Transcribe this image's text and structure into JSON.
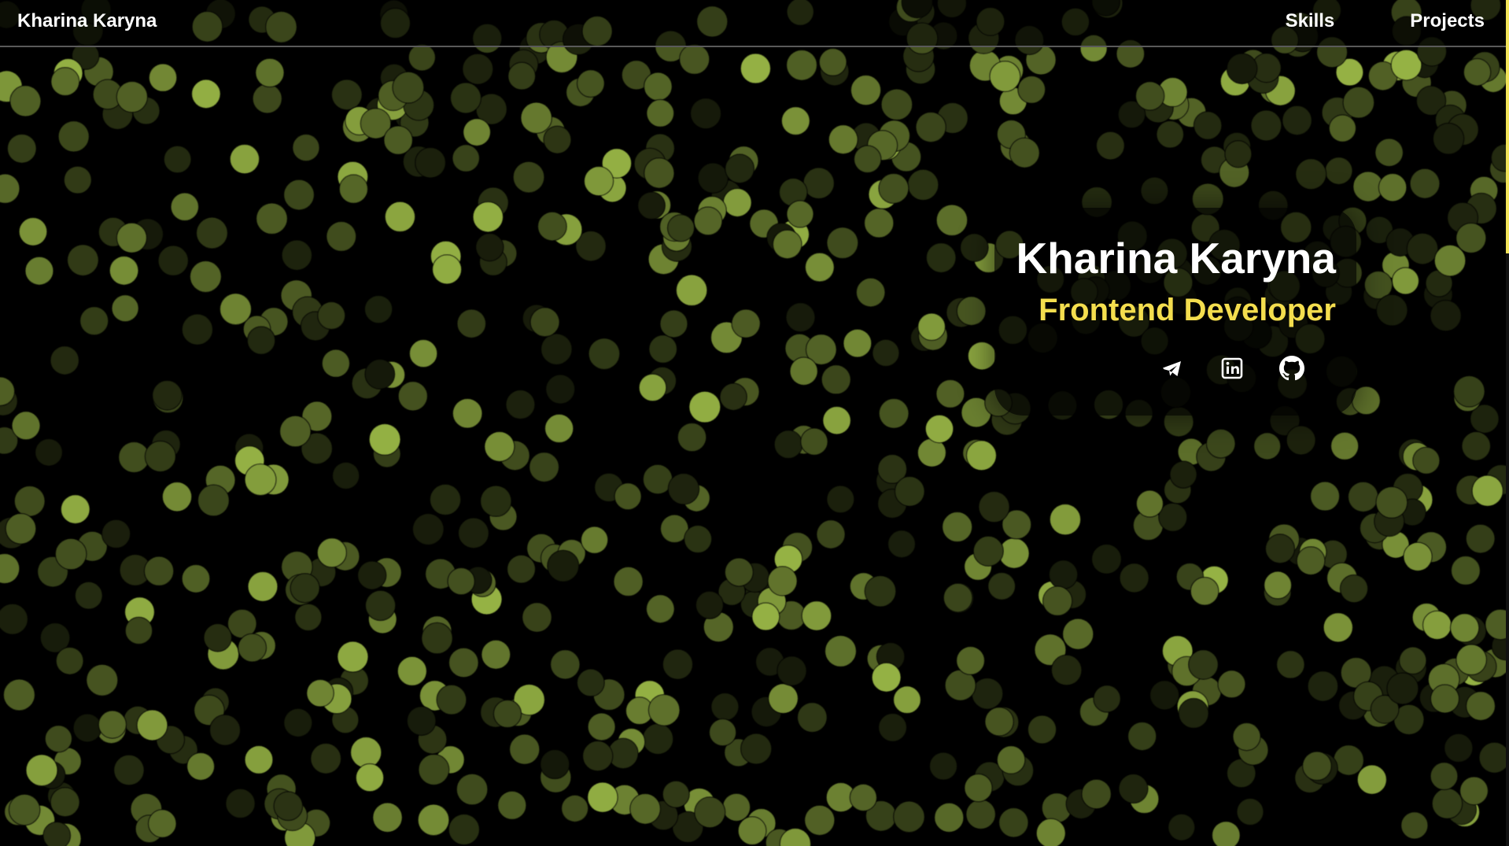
{
  "header": {
    "brand": "Kharina Karyna",
    "nav": [
      {
        "label": "Skills"
      },
      {
        "label": "Projects"
      }
    ]
  },
  "hero": {
    "name": "Kharina Karyna",
    "role": "Frontend Developer",
    "socials": [
      {
        "icon": "telegram-icon"
      },
      {
        "icon": "linkedin-icon"
      },
      {
        "icon": "github-icon"
      }
    ]
  },
  "colors": {
    "background": "#000000",
    "accent": "#f4de4e",
    "bokeh": "#a6c64c",
    "text": "#ffffff"
  }
}
